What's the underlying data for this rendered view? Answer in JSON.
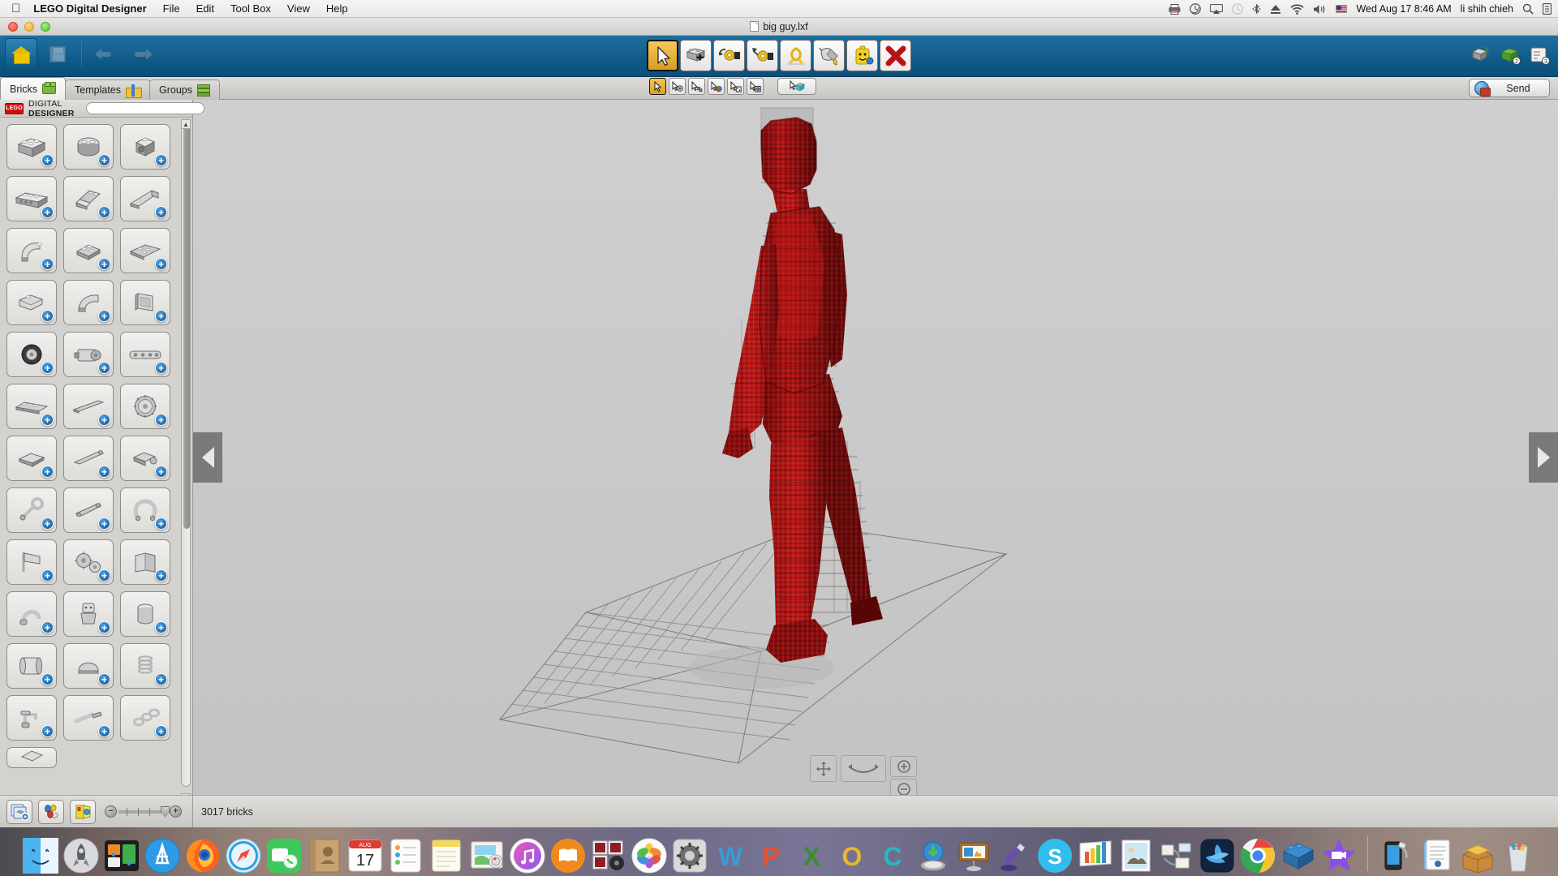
{
  "menubar": {
    "apple_icon": "apple-logo",
    "app_name": "LEGO Digital Designer",
    "menus": [
      "File",
      "Edit",
      "Tool Box",
      "View",
      "Help"
    ],
    "status_icons": [
      "printer-icon",
      "time-machine-icon",
      "airplay-icon",
      "clock-history-icon",
      "bluetooth-icon",
      "eject-icon",
      "wifi-icon",
      "volume-icon",
      "us-flag-icon"
    ],
    "datetime": "Wed Aug 17  8:46 AM",
    "user": "li shih chieh",
    "spotlight_icon": "search-icon",
    "notification_icon": "notification-center-icon"
  },
  "window": {
    "title": "big guy.lxf",
    "doc_icon": "document-icon",
    "traffic_lights": [
      "close-button",
      "minimize-button",
      "zoom-button"
    ]
  },
  "toolbar": {
    "left_buttons": [
      {
        "name": "home-button",
        "icon": "home-icon"
      },
      {
        "name": "save-button",
        "icon": "save-icon"
      },
      {
        "name": "undo-button",
        "icon": "undo-arrow-icon"
      },
      {
        "name": "redo-button",
        "icon": "redo-arrow-icon"
      }
    ],
    "tools": [
      {
        "name": "selection-tool",
        "icon": "cursor-arrow-icon",
        "active": true
      },
      {
        "name": "clone-tool",
        "icon": "brick-clone-icon",
        "active": false
      },
      {
        "name": "hinge-tool",
        "icon": "hinge-rotate-icon",
        "active": false
      },
      {
        "name": "hinge-align-tool",
        "icon": "hinge-align-icon",
        "active": false
      },
      {
        "name": "flex-tool",
        "icon": "flex-hose-icon",
        "active": false
      },
      {
        "name": "paint-tool",
        "icon": "paint-bucket-icon",
        "active": false
      },
      {
        "name": "minifig-tool",
        "icon": "minifig-head-icon",
        "active": false
      },
      {
        "name": "delete-tool",
        "icon": "red-x-icon",
        "active": false
      }
    ],
    "right_buttons": [
      {
        "name": "build-mode-button",
        "icon": "build-mode-icon",
        "badge": ""
      },
      {
        "name": "view-mode-button",
        "icon": "view-mode-icon",
        "badge": "2"
      },
      {
        "name": "building-guide-button",
        "icon": "building-guide-icon",
        "badge": "3"
      }
    ]
  },
  "tabs": [
    {
      "name": "tab-bricks",
      "label": "Bricks",
      "icon": "green-brick-icon",
      "active": true
    },
    {
      "name": "tab-templates",
      "label": "Templates",
      "icon": "gift-box-icon",
      "active": false
    },
    {
      "name": "tab-groups",
      "label": "Groups",
      "icon": "brick-stack-icon",
      "active": false
    }
  ],
  "subtoolbar": {
    "buttons": [
      {
        "name": "select-single-tool",
        "icon": "cursor-icon",
        "active": true
      },
      {
        "name": "select-add-tool",
        "icon": "cursor-plus-icon",
        "active": false
      },
      {
        "name": "select-multiple-tool",
        "icon": "cursor-multi-icon",
        "active": false
      },
      {
        "name": "select-color-tool",
        "icon": "cursor-color-icon",
        "active": false
      },
      {
        "name": "select-shape-tool",
        "icon": "cursor-shape-icon",
        "active": false
      },
      {
        "name": "select-colorshape-tool",
        "icon": "cursor-color-shape-icon",
        "active": false
      }
    ],
    "group_button": {
      "name": "select-connected-tool",
      "icon": "cursor-connected-icon"
    }
  },
  "send_button": {
    "label": "Send",
    "icon": "globe-brick-icon"
  },
  "palette": {
    "brand_logo": "lego-logo",
    "brand_text_light": "DIGITAL ",
    "brand_text_bold": "DESIGNER",
    "search_placeholder": "",
    "search_value": "",
    "collapse_icon": "collapse-left-icon",
    "bricks": [
      {
        "name": "brick-2x4",
        "icon": "brick-2x4-icon"
      },
      {
        "name": "brick-round-2x2",
        "icon": "brick-round-2x2-icon"
      },
      {
        "name": "brick-1x1-socket",
        "icon": "brick-1x1-socket-icon"
      },
      {
        "name": "brick-1x6-technic",
        "icon": "brick-technic-1x6-icon"
      },
      {
        "name": "slope-2x2",
        "icon": "slope-2x2-icon"
      },
      {
        "name": "wedge-slope",
        "icon": "wedge-slope-icon"
      },
      {
        "name": "curved-brick",
        "icon": "curved-brick-icon"
      },
      {
        "name": "plate-2x2",
        "icon": "plate-2x2-icon"
      },
      {
        "name": "wedge-plate",
        "icon": "wedge-plate-icon"
      },
      {
        "name": "slope-inverted",
        "icon": "slope-inverted-icon"
      },
      {
        "name": "slope-curved-2x2",
        "icon": "slope-curved-icon"
      },
      {
        "name": "panel-1x4x3",
        "icon": "panel-icon"
      },
      {
        "name": "tire-wheel",
        "icon": "tire-icon"
      },
      {
        "name": "motor-brick",
        "icon": "motor-icon"
      },
      {
        "name": "technic-beam",
        "icon": "technic-beam-icon"
      },
      {
        "name": "plate-1x6",
        "icon": "plate-1x6-icon"
      },
      {
        "name": "technic-axle",
        "icon": "technic-axle-icon"
      },
      {
        "name": "gear-wheel",
        "icon": "gear-icon"
      },
      {
        "name": "tile-1x2",
        "icon": "tile-1x2-icon"
      },
      {
        "name": "bar-element",
        "icon": "bar-icon"
      },
      {
        "name": "hinge-plate",
        "icon": "hinge-plate-icon"
      },
      {
        "name": "wrench-tool-part",
        "icon": "wrench-part-icon"
      },
      {
        "name": "telescope-part",
        "icon": "telescope-part-icon"
      },
      {
        "name": "horseshoe-part",
        "icon": "horseshoe-part-icon"
      },
      {
        "name": "flag-part",
        "icon": "flag-part-icon"
      },
      {
        "name": "gear-set",
        "icon": "gear-set-icon"
      },
      {
        "name": "book-part",
        "icon": "book-part-icon"
      },
      {
        "name": "handle-part",
        "icon": "handle-part-icon"
      },
      {
        "name": "minifig-torso",
        "icon": "minifig-torso-icon"
      },
      {
        "name": "cylinder-part",
        "icon": "cylinder-part-icon"
      },
      {
        "name": "scroll-part",
        "icon": "scroll-part-icon"
      },
      {
        "name": "helmet-part",
        "icon": "helmet-part-icon"
      },
      {
        "name": "spring-part",
        "icon": "spring-part-icon"
      },
      {
        "name": "tap-part",
        "icon": "tap-part-icon"
      },
      {
        "name": "screwdriver-part",
        "icon": "screwdriver-part-icon"
      },
      {
        "name": "chain-part",
        "icon": "chain-part-icon"
      },
      {
        "name": "special-part",
        "icon": "special-part-icon"
      }
    ]
  },
  "bottom_tools": [
    {
      "name": "new-group-button",
      "icon": "stacked-pages-plus-icon"
    },
    {
      "name": "color-picker-button",
      "icon": "color-palette-icon"
    },
    {
      "name": "decoration-button",
      "icon": "decoration-icon"
    }
  ],
  "zoom_control": {
    "zoom_out_icon": "minus-circle-icon",
    "zoom_in_icon": "plus-circle-icon",
    "name": "brick-size-slider"
  },
  "status": {
    "brick_count": "3017 bricks"
  },
  "canvas": {
    "nav_left_icon": "prev-arrow-icon",
    "nav_right_icon": "next-arrow-icon",
    "model_color": "#a81010",
    "model_name": "big-guy-lego-figure",
    "gizmo": {
      "pan_icon": "pan-tool-icon",
      "orbit_icon": "orbit-tool-icon",
      "zoom_in_icon": "zoom-in-icon",
      "zoom_out_icon": "zoom-out-icon"
    }
  },
  "dock": {
    "items": [
      {
        "name": "dock-finder",
        "label": "Finder",
        "running": true
      },
      {
        "name": "dock-launchpad",
        "label": "Launchpad",
        "running": false
      },
      {
        "name": "dock-mission-control",
        "label": "Mission Control",
        "running": false
      },
      {
        "name": "dock-app-store",
        "label": "App Store",
        "running": false
      },
      {
        "name": "dock-firefox",
        "label": "Firefox",
        "running": true
      },
      {
        "name": "dock-safari",
        "label": "Safari",
        "running": false
      },
      {
        "name": "dock-facetime",
        "label": "FaceTime",
        "running": false
      },
      {
        "name": "dock-contacts",
        "label": "Contacts",
        "running": false
      },
      {
        "name": "dock-calendar",
        "label": "Calendar",
        "running": false
      },
      {
        "name": "dock-reminders",
        "label": "Reminders",
        "running": false
      },
      {
        "name": "dock-notes",
        "label": "Notes",
        "running": false
      },
      {
        "name": "dock-photo-booth",
        "label": "Photo Booth",
        "running": false
      },
      {
        "name": "dock-itunes",
        "label": "iTunes",
        "running": false
      },
      {
        "name": "dock-ibooks",
        "label": "iBooks",
        "running": false
      },
      {
        "name": "dock-photobooth2",
        "label": "Photo Booth",
        "running": false
      },
      {
        "name": "dock-photos",
        "label": "Photos",
        "running": false
      },
      {
        "name": "dock-system-preferences",
        "label": "System Preferences",
        "running": false
      },
      {
        "name": "dock-word",
        "label": "Microsoft Word",
        "running": false
      },
      {
        "name": "dock-powerpoint",
        "label": "Microsoft PowerPoint",
        "running": false
      },
      {
        "name": "dock-excel",
        "label": "Microsoft Excel",
        "running": false
      },
      {
        "name": "dock-outlook",
        "label": "Microsoft Outlook",
        "running": false
      },
      {
        "name": "dock-onedrive",
        "label": "OneDrive",
        "running": false
      },
      {
        "name": "dock-downloader",
        "label": "Downloader",
        "running": false
      },
      {
        "name": "dock-keynote",
        "label": "Keynote",
        "running": false
      },
      {
        "name": "dock-sketch",
        "label": "Sketch",
        "running": false
      },
      {
        "name": "dock-skype",
        "label": "Skype",
        "running": false
      },
      {
        "name": "dock-numbers",
        "label": "Numbers",
        "running": false
      },
      {
        "name": "dock-preview",
        "label": "Preview",
        "running": false
      },
      {
        "name": "dock-automator",
        "label": "Automator",
        "running": false
      },
      {
        "name": "dock-battle-net",
        "label": "Battle.net",
        "running": false
      },
      {
        "name": "dock-chrome",
        "label": "Google Chrome",
        "running": true
      },
      {
        "name": "dock-lego-digital-designer",
        "label": "LEGO Digital Designer",
        "running": true
      },
      {
        "name": "dock-imovie",
        "label": "iMovie",
        "running": true
      },
      {
        "name": "dock-itunes-sync",
        "label": "Device Sync",
        "running": false
      },
      {
        "name": "dock-documents",
        "label": "Documents",
        "running": false
      },
      {
        "name": "dock-downloads-stack",
        "label": "Downloads",
        "running": false
      },
      {
        "name": "dock-trash",
        "label": "Trash",
        "running": false
      }
    ]
  },
  "colors": {
    "toolbar_blue": "#16608f",
    "accent_gold": "#e0a92a",
    "model_red": "#a81010",
    "panel_gray": "#d4d2cf"
  }
}
